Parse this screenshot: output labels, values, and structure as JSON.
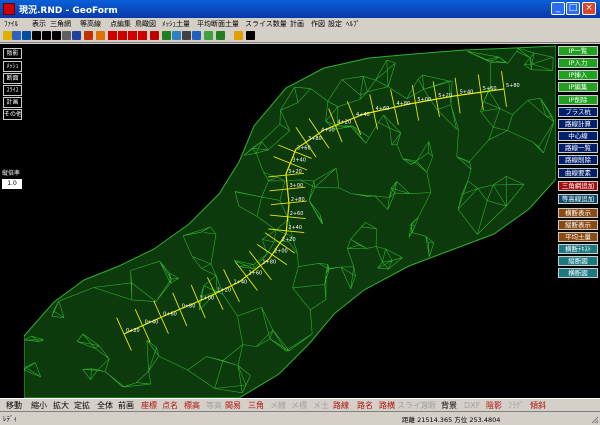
{
  "window": {
    "title": "現況.RND - GeoForm",
    "minimize_glyph": "_",
    "maximize_glyph": "□",
    "close_glyph": "×"
  },
  "menu": [
    "ﾌｧｲﾙ",
    "表示",
    "三角網",
    "等高線",
    "点編集",
    "鳥瞰図",
    "ﾒｯｼｭ土量",
    "平均断面土量",
    "スライス数量",
    "計画",
    "作図",
    "設定",
    "ﾍﾙﾌﾟ"
  ],
  "toolbar_icons": [
    "open-icon",
    "save-icon",
    "search-icon",
    "plus-icon",
    "minus-icon",
    "move-icon",
    "rotate-icon",
    "zoom-window-icon",
    "cube-red-icon",
    "cube-orange-icon",
    "arrow-up-icon",
    "arrow-down-icon",
    "arrow-left-icon",
    "arrow-right-icon",
    "move-red-icon",
    "terrain-icon",
    "render-icon",
    "print-icon",
    "layers-icon",
    "landscape-icon",
    "bird-icon",
    "help-icon",
    "pointer-icon"
  ],
  "left_panel": {
    "buttons": [
      "陰影",
      "ﾒｯｼｭ",
      "断面",
      "ｽﾗｲｽ",
      "計画",
      "その他"
    ],
    "zoom_label": "縦倍率",
    "zoom_value": "1.0"
  },
  "right_panel": [
    {
      "label": "IP一覧",
      "bg": "#1fa01f"
    },
    {
      "label": "IP入力",
      "bg": "#1fa01f"
    },
    {
      "label": "IP挿入",
      "bg": "#1fa01f"
    },
    {
      "label": "IP編集",
      "bg": "#1fa01f"
    },
    {
      "label": "IP削除",
      "bg": "#1fa01f"
    },
    {
      "label": "プラス杭",
      "bg": "#00206a"
    },
    {
      "label": "路線計算",
      "bg": "#00206a"
    },
    {
      "label": "中心線",
      "bg": "#00206a"
    },
    {
      "label": "路線一覧",
      "bg": "#00206a"
    },
    {
      "label": "路線削除",
      "bg": "#00206a"
    },
    {
      "label": "曲線要素",
      "bg": "#00206a"
    },
    {
      "label": "三角網追加",
      "bg": "#a01010"
    },
    {
      "label": "等高線追加",
      "bg": "#0a4a6a"
    },
    {
      "label": "横断表示",
      "bg": "#8a4a10"
    },
    {
      "label": "縦断表示",
      "bg": "#8a4a10"
    },
    {
      "label": "平均土量",
      "bg": "#8a4a10"
    },
    {
      "label": "横断ﾃｷｽﾄ",
      "bg": "#1a7a80"
    },
    {
      "label": "縦断図",
      "bg": "#1a7a80"
    },
    {
      "label": "横断図",
      "bg": "#1a7a80"
    }
  ],
  "bottom_buttons": [
    {
      "label": "移動",
      "color": "#000000"
    },
    {
      "label": "縮小",
      "color": "#000000"
    },
    {
      "label": "拡大",
      "color": "#000000"
    },
    {
      "label": "定拡",
      "color": "#000000"
    },
    {
      "label": "全体",
      "color": "#000000"
    },
    {
      "label": "前画",
      "color": "#000000"
    },
    {
      "label": "座標",
      "color": "#b01010"
    },
    {
      "label": "点名",
      "color": "#b01010"
    },
    {
      "label": "標高",
      "color": "#b01010"
    },
    {
      "label": "等高",
      "color": "#a0a0a0"
    },
    {
      "label": "間易",
      "color": "#b01010"
    },
    {
      "label": "三角",
      "color": "#b01010"
    },
    {
      "label": "メ線",
      "color": "#a0a0a0"
    },
    {
      "label": "メ標",
      "color": "#a0a0a0"
    },
    {
      "label": "メ土",
      "color": "#a0a0a0"
    },
    {
      "label": "路線",
      "color": "#b01010"
    },
    {
      "label": "路名",
      "color": "#b01010"
    },
    {
      "label": "路横",
      "color": "#b01010"
    },
    {
      "label": "スライス",
      "color": "#a0a0a0"
    },
    {
      "label": "方眼",
      "color": "#a0a0a0"
    },
    {
      "label": "背景",
      "color": "#000000"
    },
    {
      "label": "DXF",
      "color": "#a0a0a0"
    },
    {
      "label": "陰影",
      "color": "#b01010"
    },
    {
      "label": "ﾌﾗｸﾞ",
      "color": "#a0a0a0"
    },
    {
      "label": "傾斜",
      "color": "#b01010"
    }
  ],
  "status": {
    "ready": "ﾚﾃﾞｨ",
    "coords": "距離  21514.365 方位 253.4804"
  },
  "canvas": {
    "background": "#000000",
    "mesh_color": "#2fb02f",
    "road_color": "#e8e800",
    "stations": [
      "5+80",
      "5+60",
      "5+40",
      "5+20",
      "5+00",
      "4+80",
      "4+60",
      "4+40",
      "4+20",
      "4+00",
      "3+80",
      "3+60",
      "3+40",
      "3+20",
      "3+00",
      "2+80",
      "2+60",
      "2+40",
      "2+20",
      "2+00",
      "1+80",
      "1+60",
      "1+40",
      "1+20",
      "1+00",
      "0+80",
      "0+60",
      "0+40",
      "0+20"
    ]
  }
}
